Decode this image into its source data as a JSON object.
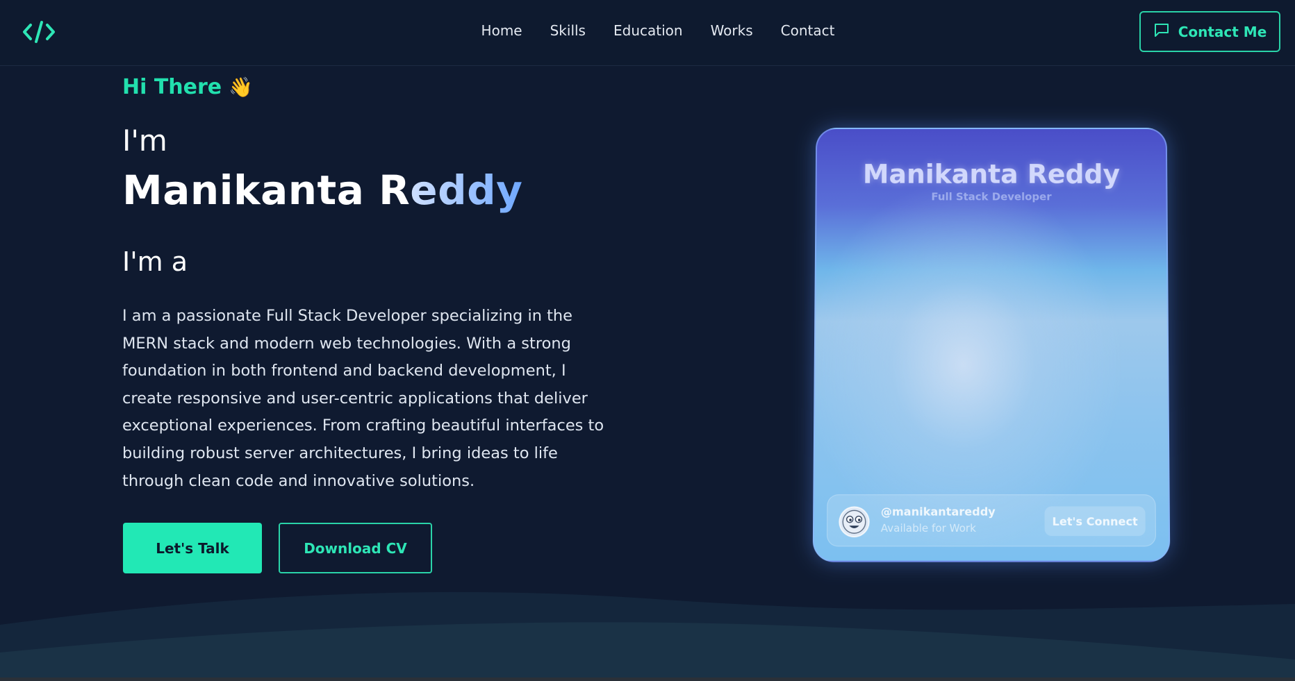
{
  "header": {
    "nav": [
      "Home",
      "Skills",
      "Education",
      "Works",
      "Contact"
    ],
    "contact_label": "Contact Me"
  },
  "hero": {
    "greeting": "Hi There",
    "wave_emoji": "👋",
    "im": "I'm",
    "name_main": "Manikanta R",
    "name_accent": "eddy",
    "ima": "I'm a",
    "description": "I am a passionate Full Stack Developer specializing in the MERN stack and modern web technologies. With a strong foundation in both frontend and backend development, I create responsive and user-centric applications that deliver exceptional experiences. From crafting beautiful interfaces to building robust server architectures, I bring ideas to life through clean code and innovative solutions.",
    "btn_talk": "Let's Talk",
    "btn_cv": "Download CV"
  },
  "card": {
    "name": "Manikanta Reddy",
    "role": "Full Stack Developer",
    "handle": "@manikantareddy",
    "status": "Available for Work",
    "connect": "Let's Connect"
  },
  "colors": {
    "accent": "#22e8b5",
    "background": "#0f1a30"
  },
  "icons": {
    "logo": "code-brackets-icon",
    "contact": "chat-bubble-icon",
    "avatar": "emoji-face-icon"
  }
}
